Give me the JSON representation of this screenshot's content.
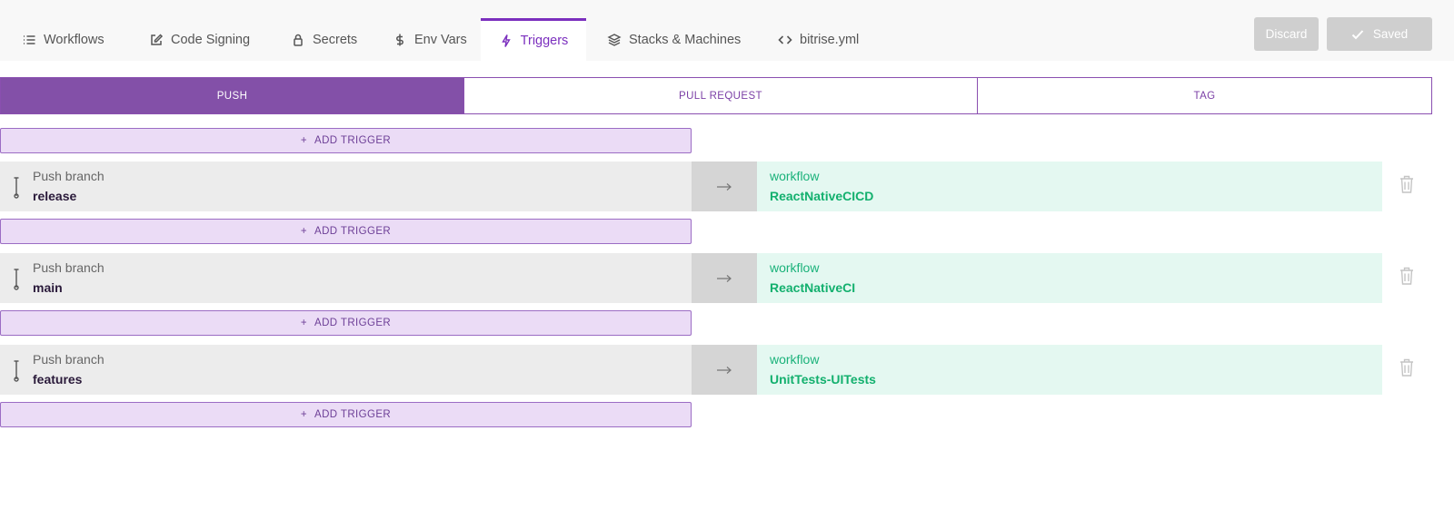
{
  "nav": {
    "tabs": [
      {
        "label": "Workflows",
        "icon": "list-icon"
      },
      {
        "label": "Code Signing",
        "icon": "edit-icon"
      },
      {
        "label": "Secrets",
        "icon": "lock-icon"
      },
      {
        "label": "Env Vars",
        "icon": "dollar-icon"
      },
      {
        "label": "Triggers",
        "icon": "bolt-icon",
        "active": true
      },
      {
        "label": "Stacks & Machines",
        "icon": "layers-icon"
      },
      {
        "label": "bitrise.yml",
        "icon": "code-icon"
      }
    ],
    "discard_label": "Discard",
    "saved_label": "Saved"
  },
  "trigger_types": {
    "tabs": [
      {
        "label": "PUSH",
        "active": true
      },
      {
        "label": "PULL REQUEST"
      },
      {
        "label": "TAG"
      }
    ]
  },
  "add_trigger": {
    "plus": "+",
    "label": "ADD TRIGGER"
  },
  "triggers": [
    {
      "type": "Push branch",
      "value": "release",
      "workflow_label": "workflow",
      "workflow": "ReactNativeCICD"
    },
    {
      "type": "Push branch",
      "value": "main",
      "workflow_label": "workflow",
      "workflow": "ReactNativeCI"
    },
    {
      "type": "Push branch",
      "value": "features",
      "workflow_label": "workflow",
      "workflow": "UnitTests-UITests"
    }
  ],
  "colors": {
    "accent": "#7b2fbe",
    "segment_active": "#8350a8",
    "add_trigger_bg": "#ebdcf6",
    "workflow_text": "#13b06e",
    "workflow_bg": "#e4f8f1"
  }
}
